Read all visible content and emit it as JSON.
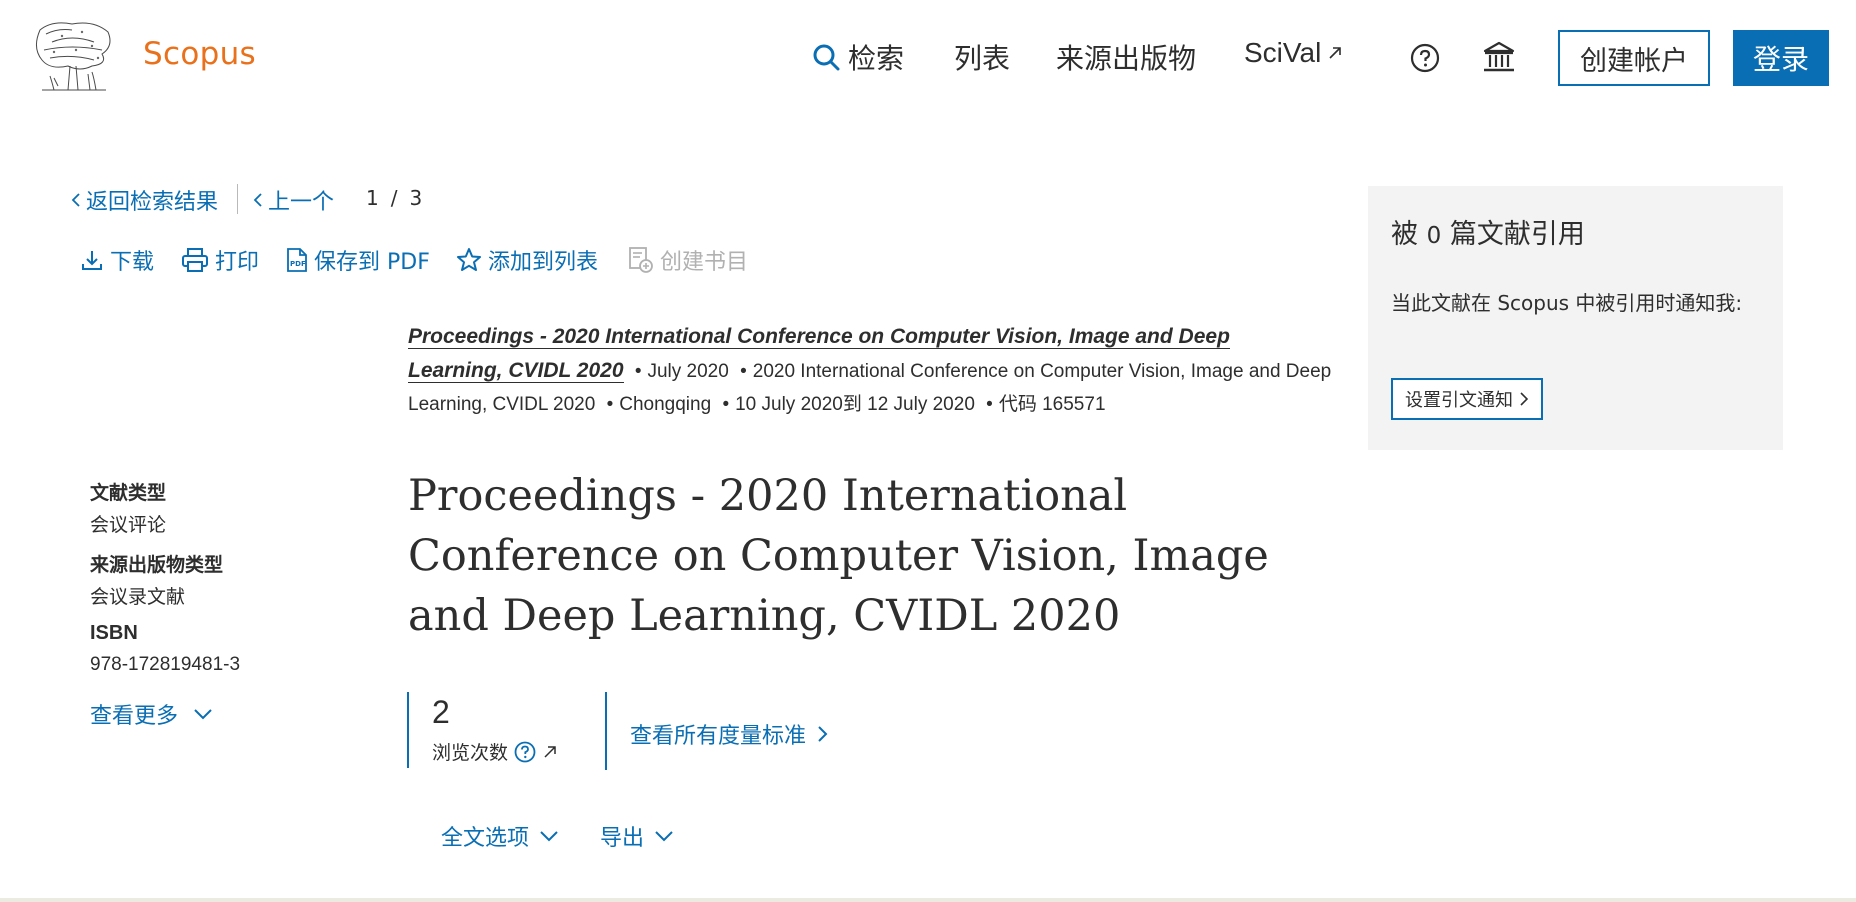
{
  "header": {
    "brand": "Scopus",
    "nav_search": "检索",
    "nav_lists": "列表",
    "nav_sources": "来源出版物",
    "nav_scival": "SciVal",
    "create_account": "创建帐户",
    "login": "登录"
  },
  "breadcrumb": {
    "back": "返回检索结果",
    "previous": "上一个",
    "current": "1",
    "separator": "/",
    "total": "3"
  },
  "toolbar": {
    "download": "下载",
    "print": "打印",
    "save_pdf": "保存到 PDF",
    "add_to_list": "添加到列表",
    "create_bibliography": "创建书目"
  },
  "source": {
    "title": "Proceedings - 2020 International Conference on Computer Vision, Image and Deep Learning, CVIDL 2020",
    "title_line1": "Proceedings - 2020 International Conference on Computer Vision, Image and Deep",
    "title_line2": "Learning, CVIDL 2020",
    "date": "July 2020",
    "conference": "2020 International Conference on Computer Vision, Image and Deep Learning, CVIDL 2020",
    "location": "Chongqing",
    "dates": "10 July 2020到 12 July 2020",
    "code": "代码 165571",
    "bullet": "•"
  },
  "meta": {
    "doc_type_label": "文献类型",
    "doc_type_value": "会议评论",
    "source_type_label": "来源出版物类型",
    "source_type_value": "会议录文献",
    "isbn_label": "ISBN",
    "isbn_value": "978-172819481-3",
    "see_more": "查看更多"
  },
  "main": {
    "title": "Proceedings - 2020 International Conference on Computer Vision, Image and Deep Learning, CVIDL 2020"
  },
  "metrics": {
    "views_value": "2",
    "views_label": "浏览次数",
    "view_all": "查看所有度量标准"
  },
  "options": {
    "full_text": "全文选项",
    "export": "导出"
  },
  "panel": {
    "cited_prefix": "被",
    "cited_count": "0",
    "cited_suffix": "篇文献引用",
    "notify_text": "当此文献在 Scopus 中被引用时通知我:",
    "set_alert": "设置引文通知"
  },
  "colors": {
    "accent": "#0a6eb4",
    "brand": "#e9711c",
    "panel_bg": "#f3f3f3"
  }
}
